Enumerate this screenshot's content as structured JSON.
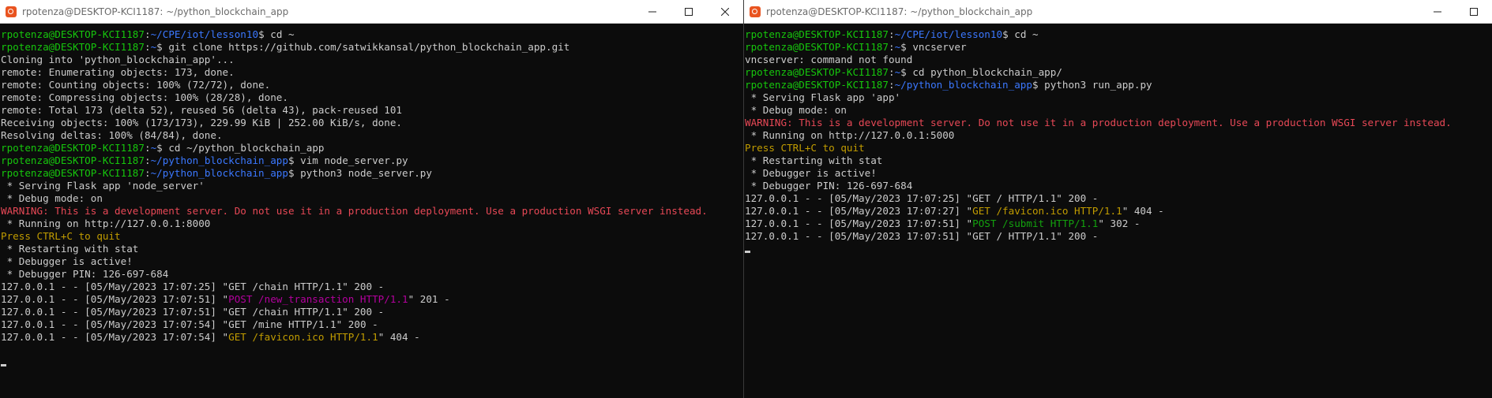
{
  "colors": {
    "user": "#16c60c",
    "path": "#3b78ff",
    "warning": "#e74856",
    "yellow": "#c19c00",
    "magenta": "#b4009e",
    "green": "#13a10e",
    "text": "#cccccc"
  },
  "left": {
    "title": "rpotenza@DESKTOP-KCI1187: ~/python_blockchain_app",
    "lines": [
      {
        "user": "rpotenza@DESKTOP-KCI1187",
        "path": "~/CPE/iot/lesson10",
        "cmd": " cd ~"
      },
      {
        "user": "rpotenza@DESKTOP-KCI1187",
        "path": "~",
        "cmd": " git clone https://github.com/satwikkansal/python_blockchain_app.git"
      },
      {
        "text": "Cloning into 'python_blockchain_app'..."
      },
      {
        "text": "remote: Enumerating objects: 173, done."
      },
      {
        "text": "remote: Counting objects: 100% (72/72), done."
      },
      {
        "text": "remote: Compressing objects: 100% (28/28), done."
      },
      {
        "text": "remote: Total 173 (delta 52), reused 56 (delta 43), pack-reused 101"
      },
      {
        "text": "Receiving objects: 100% (173/173), 229.99 KiB | 252.00 KiB/s, done."
      },
      {
        "text": "Resolving deltas: 100% (84/84), done."
      },
      {
        "user": "rpotenza@DESKTOP-KCI1187",
        "path": "~",
        "cmd": " cd ~/python_blockchain_app"
      },
      {
        "user": "rpotenza@DESKTOP-KCI1187",
        "path": "~/python_blockchain_app",
        "cmd": " vim node_server.py"
      },
      {
        "user": "rpotenza@DESKTOP-KCI1187",
        "path": "~/python_blockchain_app",
        "cmd": " python3 node_server.py"
      },
      {
        "text": " * Serving Flask app 'node_server'"
      },
      {
        "text": " * Debug mode: on"
      },
      {
        "text": "WARNING: This is a development server. Do not use it in a production deployment. Use a production WSGI server instead.",
        "color": "w"
      },
      {
        "text": " * Running on http://127.0.0.1:8000"
      },
      {
        "text": "Press CTRL+C to quit",
        "color": "y"
      },
      {
        "text": " * Restarting with stat"
      },
      {
        "text": " * Debugger is active!"
      },
      {
        "text": " * Debugger PIN: 126-697-684"
      },
      {
        "pre": "127.0.0.1 - - [05/May/2023 17:07:25] \"",
        "req": "GET /chain HTTP/1.1",
        "post": "\" 200 -"
      },
      {
        "pre": "127.0.0.1 - - [05/May/2023 17:07:51] \"",
        "req": "POST /new_transaction HTTP/1.1",
        "reqColor": "m",
        "post": "\" 201 -"
      },
      {
        "pre": "127.0.0.1 - - [05/May/2023 17:07:51] \"",
        "req": "GET /chain HTTP/1.1",
        "post": "\" 200 -"
      },
      {
        "pre": "127.0.0.1 - - [05/May/2023 17:07:54] \"",
        "req": "GET /mine HTTP/1.1",
        "post": "\" 200 -"
      },
      {
        "pre": "127.0.0.1 - - [05/May/2023 17:07:54] \"",
        "req": "GET /favicon.ico HTTP/1.1",
        "reqColor": "y",
        "post": "\" 404 -"
      },
      {
        "text": ""
      },
      {
        "cursor": true
      }
    ]
  },
  "right": {
    "title": "rpotenza@DESKTOP-KCI1187: ~/python_blockchain_app",
    "lines": [
      {
        "user": "rpotenza@DESKTOP-KCI1187",
        "path": "~/CPE/iot/lesson10",
        "cmd": " cd ~"
      },
      {
        "user": "rpotenza@DESKTOP-KCI1187",
        "path": "~",
        "cmd": " vncserver"
      },
      {
        "text": "vncserver: command not found"
      },
      {
        "user": "rpotenza@DESKTOP-KCI1187",
        "path": "~",
        "cmd": " cd python_blockchain_app/"
      },
      {
        "user": "rpotenza@DESKTOP-KCI1187",
        "path": "~/python_blockchain_app",
        "cmd": " python3 run_app.py"
      },
      {
        "text": " * Serving Flask app 'app'"
      },
      {
        "text": " * Debug mode: on"
      },
      {
        "text": "WARNING: This is a development server. Do not use it in a production deployment. Use a production WSGI server instead.",
        "color": "w"
      },
      {
        "text": " * Running on http://127.0.0.1:5000"
      },
      {
        "text": "Press CTRL+C to quit",
        "color": "y"
      },
      {
        "text": " * Restarting with stat"
      },
      {
        "text": " * Debugger is active!"
      },
      {
        "text": " * Debugger PIN: 126-697-684"
      },
      {
        "pre": "127.0.0.1 - - [05/May/2023 17:07:25] \"",
        "req": "GET / HTTP/1.1",
        "post": "\" 200 -"
      },
      {
        "pre": "127.0.0.1 - - [05/May/2023 17:07:27] \"",
        "req": "GET /favicon.ico HTTP/1.1",
        "reqColor": "y",
        "post": "\" 404 -"
      },
      {
        "pre": "127.0.0.1 - - [05/May/2023 17:07:51] \"",
        "req": "POST /submit HTTP/1.1",
        "reqColor": "g",
        "post": "\" 302 -"
      },
      {
        "pre": "127.0.0.1 - - [05/May/2023 17:07:51] \"",
        "req": "GET / HTTP/1.1",
        "post": "\" 200 -"
      },
      {
        "cursor": true
      }
    ]
  }
}
